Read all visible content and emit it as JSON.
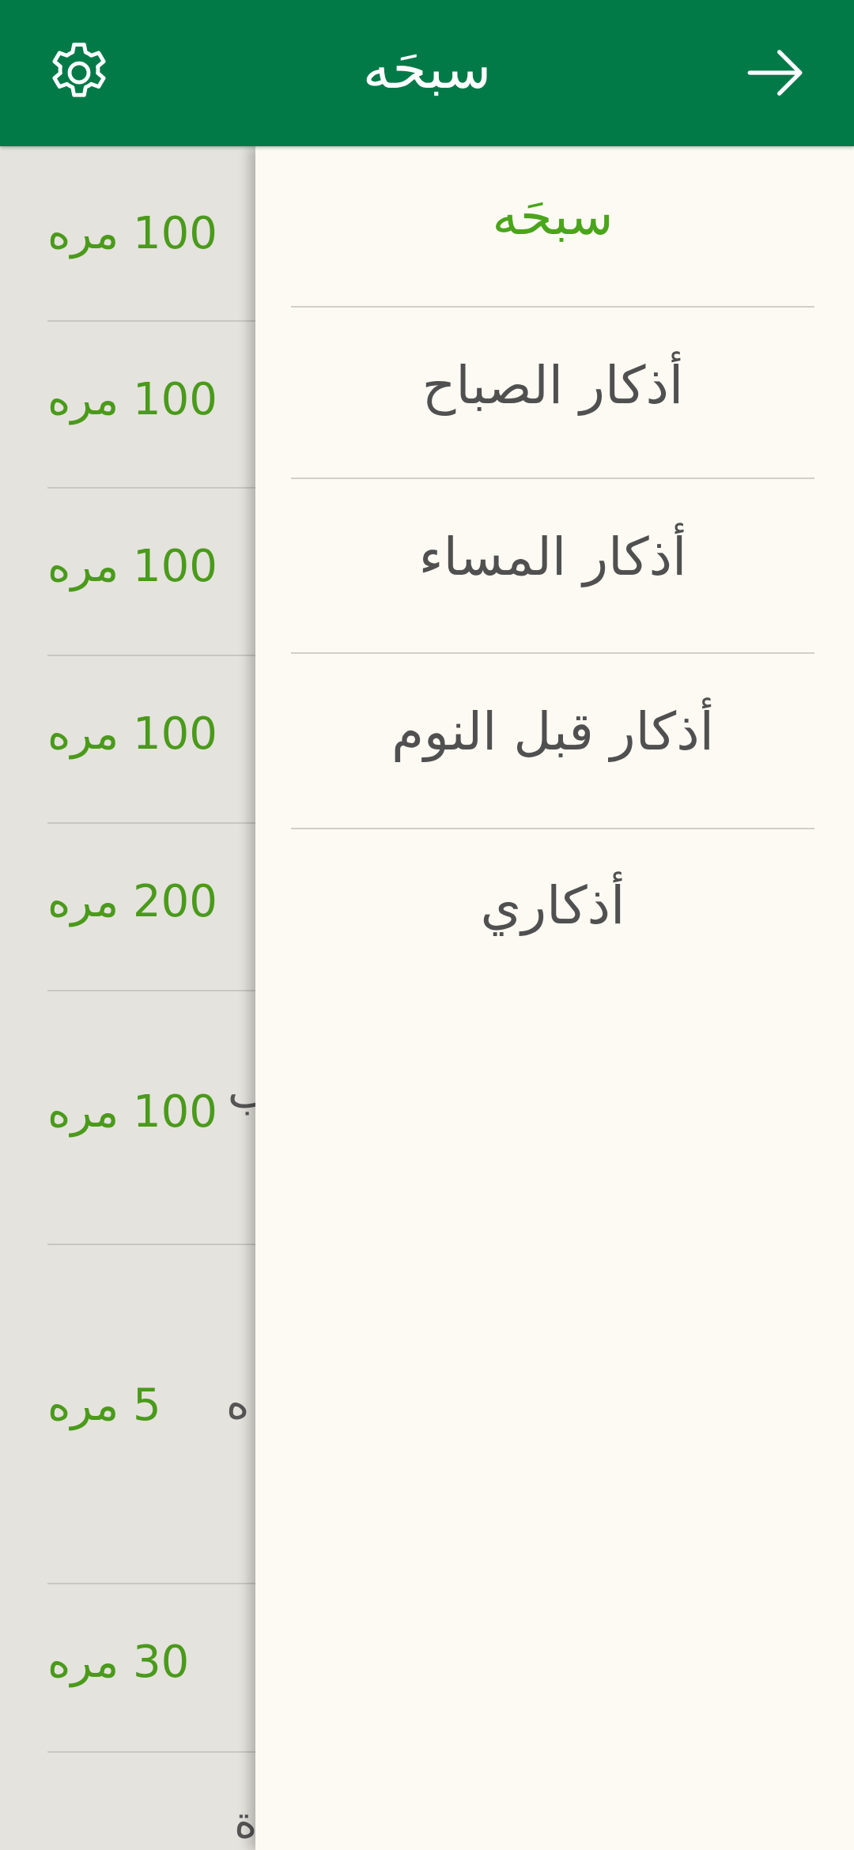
{
  "header": {
    "title": "سبحَه",
    "settings_icon": "gear-icon",
    "back_icon": "arrow-right-icon"
  },
  "colors": {
    "app_bar": "#017a48",
    "accent": "#4aa51b",
    "count_text": "#4a9a1b",
    "drawer_bg": "#fdfaf3",
    "list_bg": "#e5e3dd"
  },
  "drawer": {
    "items": [
      {
        "label": "سبحَه",
        "active": true
      },
      {
        "label": "أذكار الصباح",
        "active": false
      },
      {
        "label": "أذكار المساء",
        "active": false
      },
      {
        "label": "أذكار قبل النوم",
        "active": false
      },
      {
        "label": "أذكاري",
        "active": false
      }
    ]
  },
  "list": {
    "rows": [
      {
        "count": "100 مره",
        "fragment": ""
      },
      {
        "count": "100 مره",
        "fragment": ""
      },
      {
        "count": "100 مره",
        "fragment": ""
      },
      {
        "count": "100 مره",
        "fragment": ""
      },
      {
        "count": "200 مره",
        "fragment": ""
      },
      {
        "count": "100 مره",
        "fragment": "ب"
      },
      {
        "count": "5 مره",
        "fragment": "ه"
      },
      {
        "count": "30 مره",
        "fragment": ""
      },
      {
        "count": "",
        "fragment": "ة"
      }
    ]
  }
}
